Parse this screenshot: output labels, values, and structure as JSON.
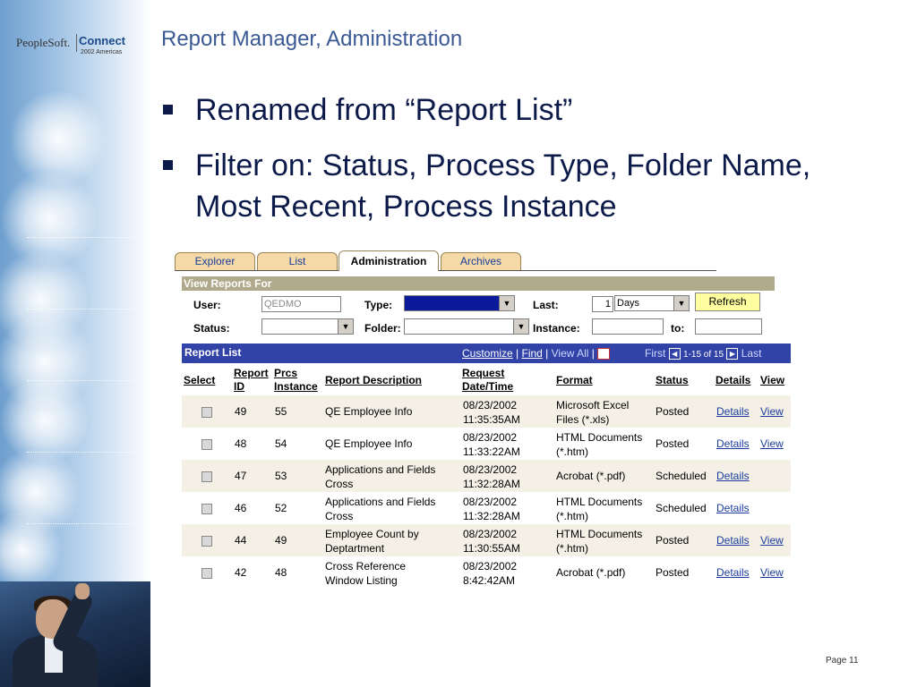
{
  "logo": {
    "brand": "PeopleSoft.",
    "product": "Connect",
    "sub": "2002 Americas"
  },
  "slide": {
    "title": "Report Manager, Administration",
    "bullets": [
      "Renamed from “Report List”",
      "Filter on: Status, Process Type, Folder Name, Most Recent, Process Instance"
    ],
    "page": "Page 11"
  },
  "screenshot": {
    "tabs": [
      "Explorer",
      "List",
      "Administration",
      "Archives"
    ],
    "active_tab": "Administration",
    "view_reports_for": "View Reports For",
    "filters": {
      "user_label": "User:",
      "user_value": "QEDMO",
      "type_label": "Type:",
      "last_label": "Last:",
      "last_value": "1",
      "last_unit": "Days",
      "refresh_label": "Refresh",
      "status_label": "Status:",
      "folder_label": "Folder:",
      "instance_label": "Instance:",
      "to_label": "to:"
    },
    "report_list": {
      "title": "Report List",
      "customize": "Customize",
      "find": "Find",
      "view_all": "View All",
      "first": "First",
      "range": "1-15 of 15",
      "last": "Last",
      "columns": {
        "select": "Select",
        "report_id_1": "Report",
        "report_id_2": "ID",
        "prcs_1": "Prcs",
        "prcs_2": "Instance",
        "description": "Report Description",
        "request_1": "Request",
        "request_2": "Date/Time",
        "format": "Format",
        "status": "Status",
        "details": "Details",
        "view": "View"
      },
      "rows": [
        {
          "id": "49",
          "instance": "55",
          "desc1": "QE Employee Info",
          "desc2": "",
          "date": "08/23/2002",
          "time": "11:35:35AM",
          "fmt1": "Microsoft Excel",
          "fmt2": "Files (*.xls)",
          "status": "Posted",
          "details": "Details",
          "view": "View"
        },
        {
          "id": "48",
          "instance": "54",
          "desc1": "QE Employee Info",
          "desc2": "",
          "date": "08/23/2002",
          "time": "11:33:22AM",
          "fmt1": "HTML Documents",
          "fmt2": "(*.htm)",
          "status": "Posted",
          "details": "Details",
          "view": "View"
        },
        {
          "id": "47",
          "instance": "53",
          "desc1": "Applications and Fields",
          "desc2": "Cross",
          "date": "08/23/2002",
          "time": "11:32:28AM",
          "fmt1": "Acrobat (*.pdf)",
          "fmt2": "",
          "status": "Scheduled",
          "details": "Details",
          "view": ""
        },
        {
          "id": "46",
          "instance": "52",
          "desc1": "Applications and Fields",
          "desc2": "Cross",
          "date": "08/23/2002",
          "time": "11:32:28AM",
          "fmt1": "HTML Documents",
          "fmt2": "(*.htm)",
          "status": "Scheduled",
          "details": "Details",
          "view": ""
        },
        {
          "id": "44",
          "instance": "49",
          "desc1": "Employee Count by",
          "desc2": "Deptartment",
          "date": "08/23/2002",
          "time": "11:30:55AM",
          "fmt1": "HTML Documents",
          "fmt2": "(*.htm)",
          "status": "Posted",
          "details": "Details",
          "view": "View"
        },
        {
          "id": "42",
          "instance": "48",
          "desc1": "Cross Reference",
          "desc2": "Window Listing",
          "date": "08/23/2002",
          "time": "8:42:42AM",
          "fmt1": "Acrobat (*.pdf)",
          "fmt2": "",
          "status": "Posted",
          "details": "Details",
          "view": "View"
        }
      ]
    }
  }
}
